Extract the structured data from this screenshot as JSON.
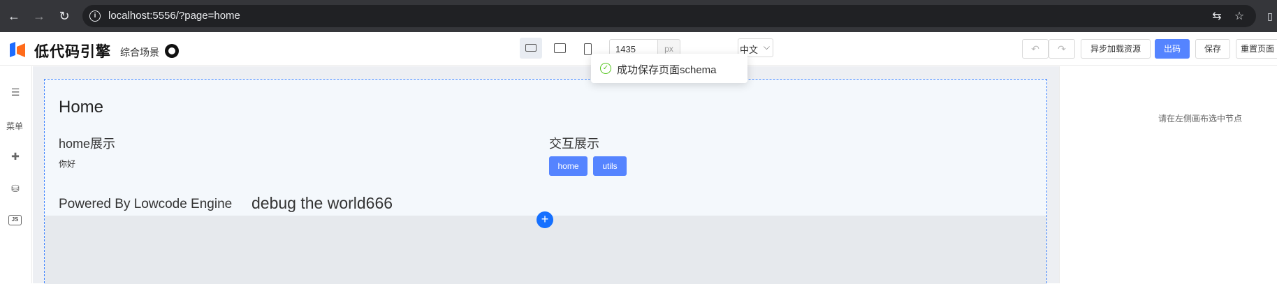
{
  "browser": {
    "url": "localhost:5556/?page=home",
    "back_icon": "arrow-left-icon",
    "forward_icon": "arrow-right-icon",
    "reload_icon": "reload-icon",
    "info_icon": "info-icon",
    "translate_icon": "translate-icon",
    "bookmark_icon": "star-icon",
    "sidebar_icon": "side-panel-icon"
  },
  "topbar": {
    "logo_text": "低代码引擎",
    "scene_label": "综合场景",
    "github_icon": "github-icon",
    "devices": [
      "desktop-icon",
      "tablet-icon",
      "phone-icon"
    ],
    "canvas_width_value": "1435",
    "px_unit": "px",
    "language": "中文",
    "undo_icon": "undo-icon",
    "redo_icon": "redo-icon",
    "async_load_label": "异步加载资源",
    "export_label": "出码",
    "save_label": "保存",
    "reset_label": "重置页面"
  },
  "toast": {
    "message": "成功保存页面schema",
    "status": "success"
  },
  "left_panel": {
    "menu_label": "菜单",
    "icons": [
      "outline-tree-icon",
      "component-library-icon",
      "data-source-icon",
      "code-js-icon"
    ],
    "js_label": "JS"
  },
  "canvas": {
    "page_title": "Home",
    "section_left_title": "home展示",
    "hello_text": "你好",
    "section_right_title": "交互展示",
    "button_home": "home",
    "button_utils": "utils",
    "powered_by": "Powered By Lowcode Engine",
    "debug_text": "debug the world666",
    "add_icon": "plus-icon"
  },
  "right_panel": {
    "hint": "请在左侧画布选中节点"
  },
  "colors": {
    "primary": "#5584ff",
    "selection_border": "#3f84ff",
    "success": "#52c41a",
    "add_button": "#1570ff"
  }
}
